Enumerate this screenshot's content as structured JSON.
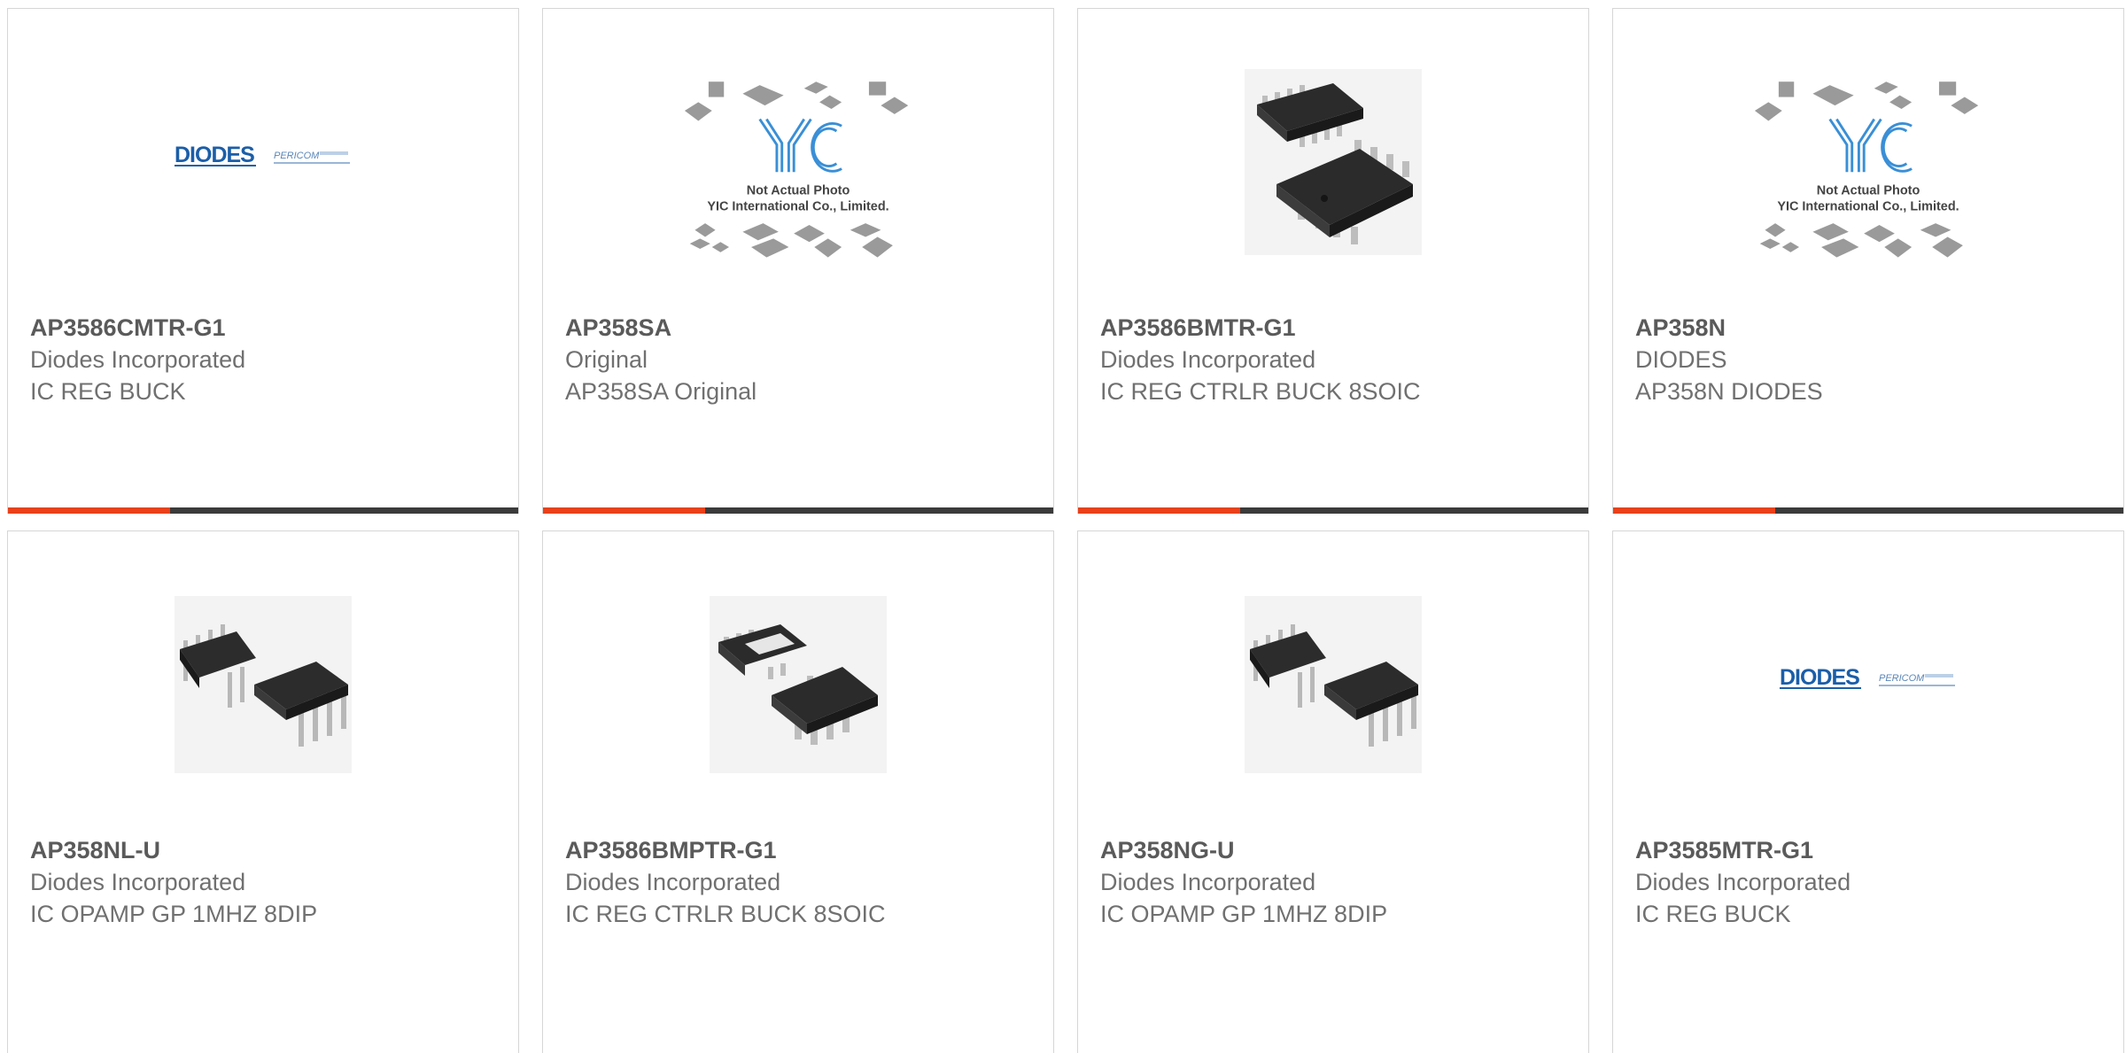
{
  "colors": {
    "accent": "#e8411b",
    "bar": "#3b3b3b",
    "border": "#d6d6d6",
    "text": "#707070"
  },
  "products": [
    {
      "part": "AP3586CMTR-G1",
      "maker": "Diodes Incorporated",
      "desc": "IC REG BUCK",
      "image": "diodes-logo-icon"
    },
    {
      "part": "AP358SA",
      "maker": "Original",
      "desc": "AP358SA Original",
      "image": "yic-placeholder-icon",
      "image_text": [
        "YIC",
        "Not Actual Photo",
        "YIC International Co., Limited."
      ]
    },
    {
      "part": "AP3586BMTR-G1",
      "maker": "Diodes Incorporated",
      "desc": "IC REG CTRLR BUCK 8SOIC",
      "image": "soic8-chip-icon"
    },
    {
      "part": "AP358N",
      "maker": "DIODES",
      "desc": "AP358N DIODES",
      "image": "yic-placeholder-icon",
      "image_text": [
        "YIC",
        "Not Actual Photo",
        "YIC International Co., Limited."
      ]
    },
    {
      "part": "AP358NL-U",
      "maker": "Diodes Incorporated",
      "desc": "IC OPAMP GP 1MHZ 8DIP",
      "image": "dip8-chip-icon"
    },
    {
      "part": "AP3586BMPTR-G1",
      "maker": "Diodes Incorporated",
      "desc": "IC REG CTRLR BUCK 8SOIC",
      "image": "soic8-chip-icon"
    },
    {
      "part": "AP358NG-U",
      "maker": "Diodes Incorporated",
      "desc": "IC OPAMP GP 1MHZ 8DIP",
      "image": "dip8-chip-icon"
    },
    {
      "part": "AP3585MTR-G1",
      "maker": "Diodes Incorporated",
      "desc": "IC REG BUCK",
      "image": "diodes-logo-icon"
    }
  ],
  "logo": {
    "brand": "DIODES",
    "sub": "PERICOM"
  }
}
